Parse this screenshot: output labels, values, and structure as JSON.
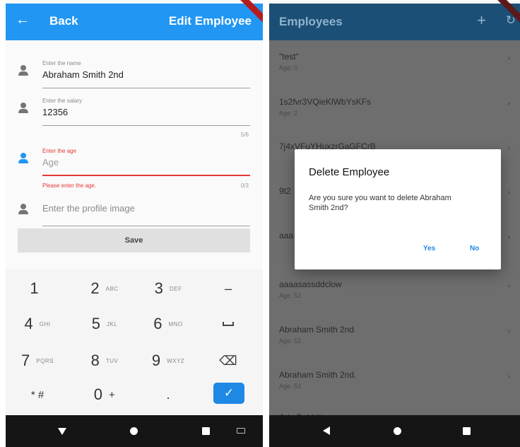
{
  "edit_screen": {
    "header": {
      "back_label": "Back",
      "title": "Edit Employee"
    },
    "fields": [
      {
        "label": "Enter the name",
        "value": "Abraham Smith 2nd",
        "counter": ""
      },
      {
        "label": "Enter the salary",
        "value": "12356",
        "counter": "5/6"
      },
      {
        "label": "Enter the age",
        "value": "Age",
        "counter": "0/3",
        "error": "Please enter the age."
      },
      {
        "label": "",
        "value": "Enter the profile image",
        "counter": ""
      }
    ],
    "save_label": "Save",
    "keypad": {
      "rows": [
        [
          {
            "digit": "1",
            "letters": ""
          },
          {
            "digit": "2",
            "letters": "ABC"
          },
          {
            "digit": "3",
            "letters": "DEF"
          },
          {
            "digit": "–",
            "letters": ""
          }
        ],
        [
          {
            "digit": "4",
            "letters": "GHI"
          },
          {
            "digit": "5",
            "letters": "JKL"
          },
          {
            "digit": "6",
            "letters": "MNO"
          },
          {
            "digit": "",
            "letters": ""
          }
        ],
        [
          {
            "digit": "7",
            "letters": "PQRS"
          },
          {
            "digit": "8",
            "letters": "TUV"
          },
          {
            "digit": "9",
            "letters": "WXYZ"
          },
          {
            "digit": "",
            "letters": ""
          }
        ],
        [
          {
            "digit": "* #",
            "letters": ""
          },
          {
            "digit": "0",
            "letters": "+"
          },
          {
            "digit": ".",
            "letters": ""
          },
          {
            "digit": "",
            "letters": ""
          }
        ]
      ],
      "backspace_icon": "⌫",
      "done_icon": "✓"
    },
    "colors": {
      "primary": "#2196f3",
      "error": "#e53935"
    }
  },
  "list_screen": {
    "header": {
      "title": "Employees",
      "add_icon": "+",
      "refresh_icon": "↻"
    },
    "employees": [
      {
        "name": "\"test\"",
        "age": "Age: 0"
      },
      {
        "name": "1s2fvr3VQieKlWbYsKFs",
        "age": "Age: 2"
      },
      {
        "name": "7j4xVFuYHuxzrGaGFCrB",
        "age": ""
      },
      {
        "name": "9t2",
        "age": ""
      },
      {
        "name": "aaa",
        "age": ""
      },
      {
        "name": "aaaasassddclow",
        "age": "Age: 52"
      },
      {
        "name": "Abraham Smith 2nd",
        "age": "Age: 52"
      },
      {
        "name": "Abraham Smith 2nd.",
        "age": "Age: 52"
      },
      {
        "name": "Ada Bobbitt",
        "age": ""
      }
    ],
    "dialog": {
      "title": "Delete Employee",
      "message": "Are you sure you want to delete Abraham Smith 2nd?",
      "yes_label": "Yes",
      "no_label": "No"
    }
  }
}
